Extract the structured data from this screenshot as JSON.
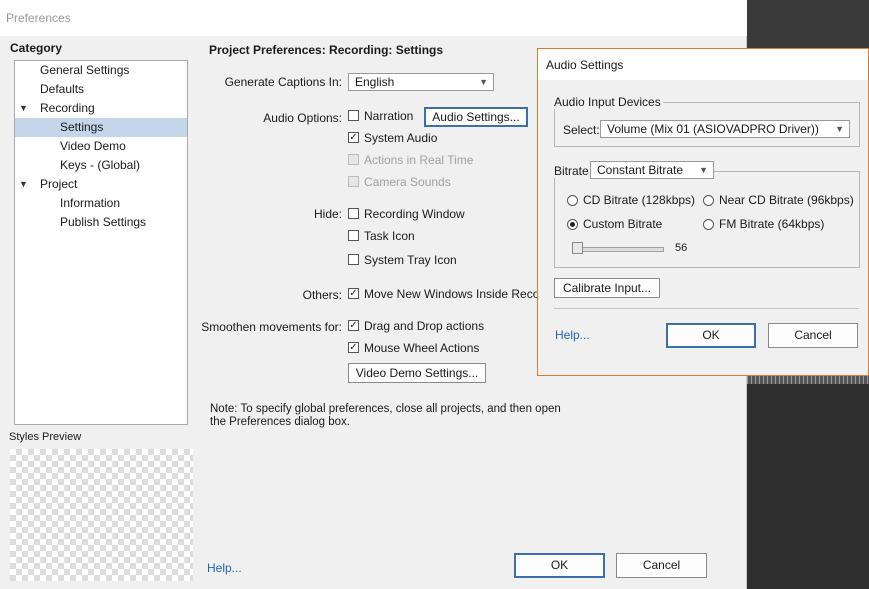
{
  "preferences": {
    "title": "Preferences",
    "category_label": "Category",
    "tree": [
      {
        "label": "General Settings",
        "level": 1
      },
      {
        "label": "Defaults",
        "level": 1
      },
      {
        "label": "Recording",
        "level": 0,
        "expanded": true
      },
      {
        "label": "Settings",
        "level": 2,
        "selected": true
      },
      {
        "label": "Video Demo",
        "level": 2
      },
      {
        "label": "Keys - (Global)",
        "level": 2
      },
      {
        "label": "Project",
        "level": 0,
        "expanded": true
      },
      {
        "label": "Information",
        "level": 2
      },
      {
        "label": "Publish Settings",
        "level": 2
      }
    ],
    "styles_preview_label": "Styles Preview",
    "section_title": "Project Preferences: Recording: Settings",
    "captions": {
      "label": "Generate Captions In:",
      "value": "English"
    },
    "audio_options": {
      "label": "Audio Options:",
      "narration": {
        "label": "Narration",
        "checked": false
      },
      "audio_settings_button": "Audio Settings...",
      "system_audio": {
        "label": "System Audio",
        "checked": true
      },
      "actions_realtime": {
        "label": "Actions in Real Time",
        "enabled": false
      },
      "camera_sounds": {
        "label": "Camera Sounds",
        "enabled": false
      }
    },
    "hide": {
      "label": "Hide:",
      "recording_window": {
        "label": "Recording Window",
        "checked": false
      },
      "task_icon": {
        "label": "Task Icon",
        "checked": false
      },
      "system_tray_icon": {
        "label": "System Tray Icon",
        "checked": false
      }
    },
    "others": {
      "label": "Others:",
      "move_windows": {
        "label": "Move New Windows Inside Recording Area",
        "checked": true
      }
    },
    "smoothen": {
      "label": "Smoothen movements for:",
      "drag_drop": {
        "label": "Drag and Drop actions",
        "checked": true
      },
      "mouse_wheel": {
        "label": "Mouse Wheel Actions",
        "checked": true
      }
    },
    "video_demo_button": "Video Demo Settings...",
    "note": "Note: To specify global preferences, close all projects, and then open the Preferences dialog box.",
    "help": "Help...",
    "ok": "OK",
    "cancel": "Cancel"
  },
  "audio_settings": {
    "title": "Audio Settings",
    "input_devices_legend": "Audio Input Devices",
    "select_label": "Select:",
    "select_value": "Volume (Mix 01 (ASIOVADPRO Driver))",
    "bitrate_label": "Bitrate",
    "bitrate_mode": "Constant Bitrate",
    "options": {
      "cd": "CD Bitrate (128kbps)",
      "near_cd": "Near CD Bitrate (96kbps)",
      "custom": "Custom Bitrate",
      "fm": "FM Bitrate (64kbps)"
    },
    "selected_option": "custom",
    "slider_value": "56",
    "calibrate_button": "Calibrate Input...",
    "help": "Help...",
    "ok": "OK",
    "cancel": "Cancel"
  },
  "colors": {
    "dialog_bg": "#f0f0f0",
    "selection": "#c5d5ea",
    "link": "#2266aa",
    "audio_border": "#e07a30"
  }
}
